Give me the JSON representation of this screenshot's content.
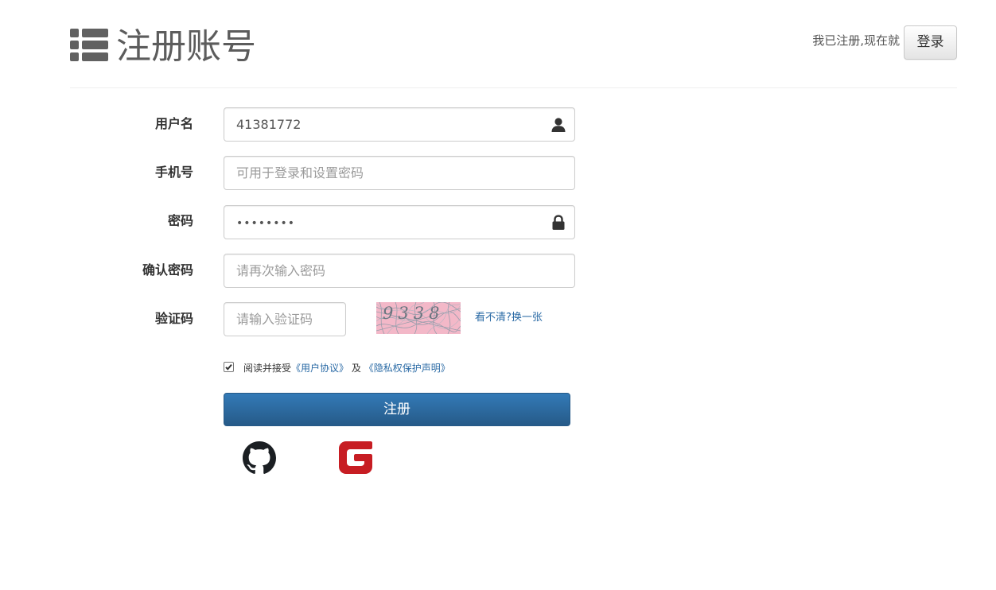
{
  "header": {
    "title": "注册账号",
    "already_text": "我已注册,现在就",
    "login_label": "登录"
  },
  "form": {
    "username": {
      "label": "用户名",
      "value": "41381772",
      "icon": "user-icon"
    },
    "phone": {
      "label": "手机号",
      "placeholder": "可用于登录和设置密码"
    },
    "password": {
      "label": "密码",
      "value": "••••••••",
      "icon": "lock-icon"
    },
    "confirm": {
      "label": "确认密码",
      "placeholder": "请再次输入密码"
    },
    "captcha": {
      "label": "验证码",
      "placeholder": "请输入验证码",
      "image_text": "9338",
      "refresh_label": "看不清?换一张"
    },
    "agreement": {
      "checked": true,
      "prefix": "阅读并接受",
      "user_agreement": "《用户协议》",
      "and": "及",
      "privacy": "《隐私权保护声明》"
    },
    "submit_label": "注册"
  },
  "social_logins": [
    {
      "name": "GitHub",
      "icon": "github-icon"
    },
    {
      "name": "Gitee",
      "icon": "gitee-icon"
    }
  ],
  "colors": {
    "primary": "#337ab7",
    "link": "#2a6aa5",
    "gitee_red": "#c71d23",
    "title": "#5c5c5c"
  }
}
